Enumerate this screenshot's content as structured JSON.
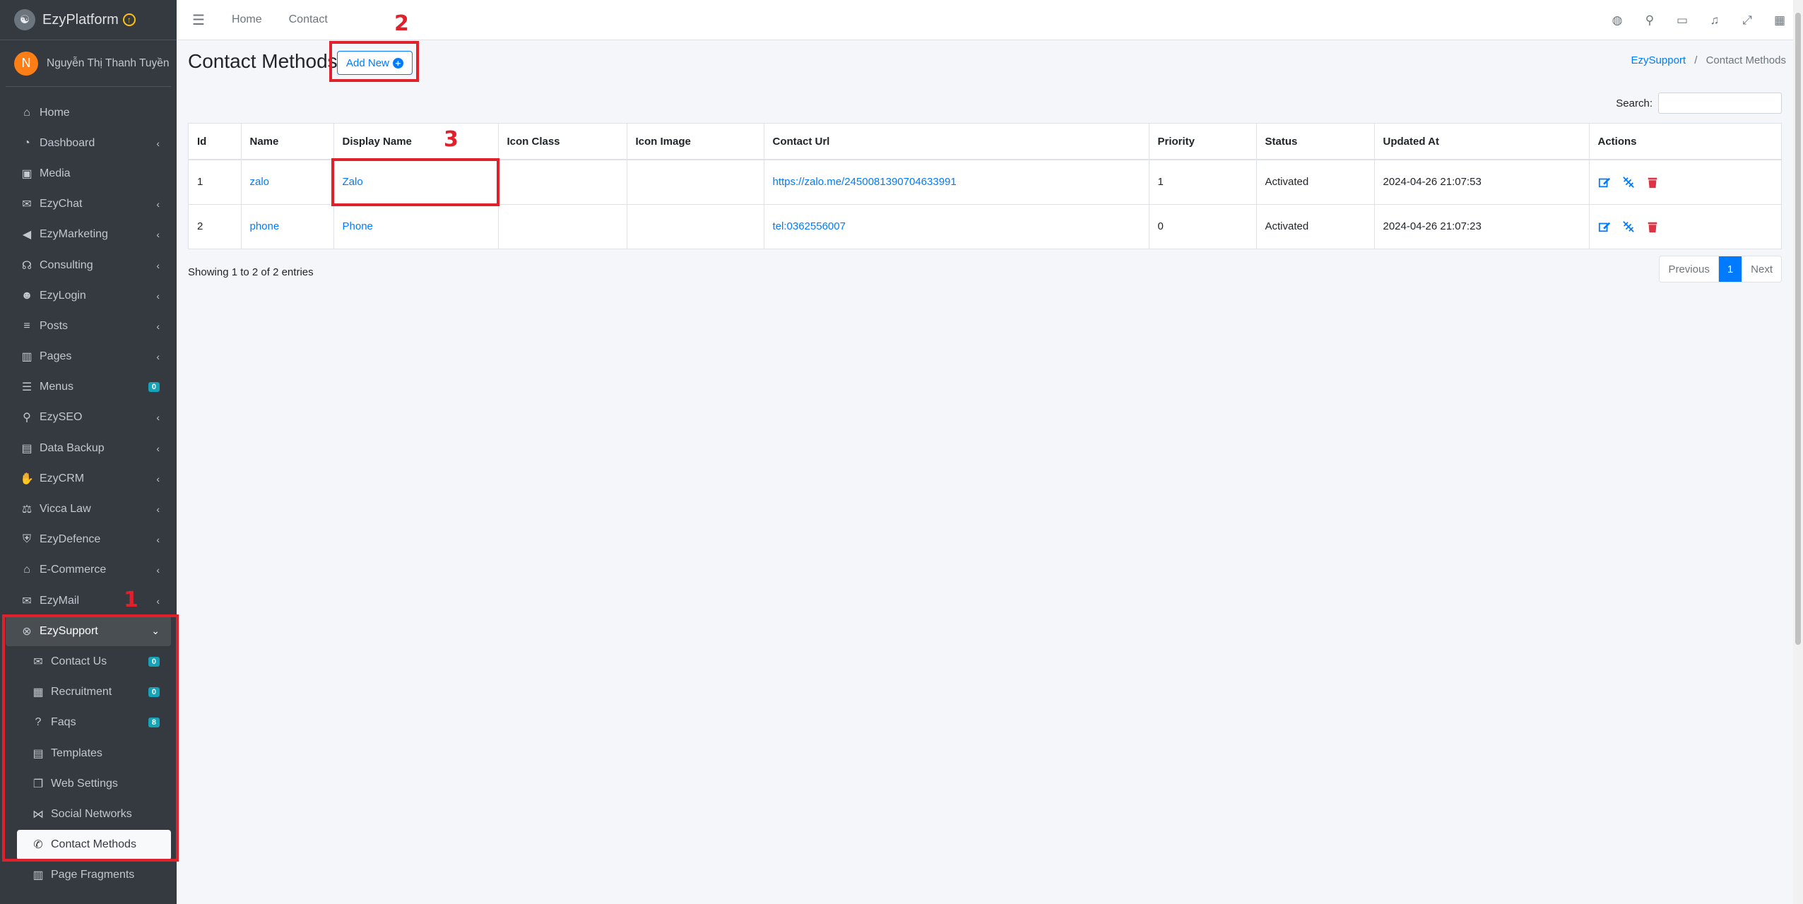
{
  "brand": {
    "name": "EzyPlatform"
  },
  "user": {
    "initial": "N",
    "name": "Nguyễn Thị Thanh Tuyền"
  },
  "sidebar": {
    "items": [
      {
        "label": "Home",
        "icon": "home-icon",
        "glyph": "⌂"
      },
      {
        "label": "Dashboard",
        "icon": "dashboard-icon",
        "glyph": "◔",
        "arrow": true
      },
      {
        "label": "Media",
        "icon": "image-icon",
        "glyph": "▣"
      },
      {
        "label": "EzyChat",
        "icon": "chat-icon",
        "glyph": "✉",
        "arrow": true
      },
      {
        "label": "EzyMarketing",
        "icon": "bullhorn-icon",
        "glyph": "◀",
        "arrow": true
      },
      {
        "label": "Consulting",
        "icon": "headset-icon",
        "glyph": "☊",
        "arrow": true
      },
      {
        "label": "EzyLogin",
        "icon": "user-lock-icon",
        "glyph": "☻",
        "arrow": true
      },
      {
        "label": "Posts",
        "icon": "list-icon",
        "glyph": "≡",
        "arrow": true
      },
      {
        "label": "Pages",
        "icon": "columns-icon",
        "glyph": "▥",
        "arrow": true
      },
      {
        "label": "Menus",
        "icon": "bars-icon",
        "glyph": "☰",
        "badge": "0"
      },
      {
        "label": "EzySEO",
        "icon": "search-plus-icon",
        "glyph": "⚲",
        "arrow": true
      },
      {
        "label": "Data Backup",
        "icon": "box-icon",
        "glyph": "▤",
        "arrow": true
      },
      {
        "label": "EzyCRM",
        "icon": "handshake-icon",
        "glyph": "✋",
        "arrow": true
      },
      {
        "label": "Vicca Law",
        "icon": "gavel-icon",
        "glyph": "⚖",
        "arrow": true
      },
      {
        "label": "EzyDefence",
        "icon": "shield-icon",
        "glyph": "⛨",
        "arrow": true
      },
      {
        "label": "E-Commerce",
        "icon": "store-icon",
        "glyph": "⌂",
        "arrow": true
      },
      {
        "label": "EzyMail",
        "icon": "envelope-icon",
        "glyph": "✉",
        "arrow": true
      }
    ],
    "open_item": {
      "label": "EzySupport",
      "icon": "support-icon",
      "glyph": "⊗"
    },
    "sub_items": [
      {
        "label": "Contact Us",
        "icon": "mailbox-icon",
        "glyph": "✉",
        "badge": "0"
      },
      {
        "label": "Recruitment",
        "icon": "grid-icon",
        "glyph": "▦",
        "badge": "0"
      },
      {
        "label": "Faqs",
        "icon": "question-icon",
        "glyph": "?",
        "badge": "8"
      },
      {
        "label": "Templates",
        "icon": "table-icon",
        "glyph": "▤"
      },
      {
        "label": "Web Settings",
        "icon": "window-icon",
        "glyph": "❐"
      },
      {
        "label": "Social Networks",
        "icon": "share-icon",
        "glyph": "⋈"
      },
      {
        "label": "Contact Methods",
        "icon": "phone-icon",
        "glyph": "✆",
        "active": true
      }
    ],
    "after_items": [
      {
        "label": "Page Fragments",
        "icon": "columns-icon",
        "glyph": "▥"
      }
    ]
  },
  "topbar": {
    "links": [
      "Home",
      "Contact"
    ],
    "icons": [
      "globe-icon",
      "search-icon",
      "comments-icon",
      "bell-icon",
      "expand-icon",
      "apps-icon"
    ]
  },
  "page": {
    "title": "Contact Methods",
    "add_button": "Add New",
    "breadcrumb": {
      "parent": "EzySupport",
      "current": "Contact Methods"
    },
    "search_label": "Search:",
    "search_value": ""
  },
  "table": {
    "columns": [
      "Id",
      "Name",
      "Display Name",
      "Icon Class",
      "Icon Image",
      "Contact Url",
      "Priority",
      "Status",
      "Updated At",
      "Actions"
    ],
    "rows": [
      {
        "id": "1",
        "name": "zalo",
        "display_name": "Zalo",
        "icon_class": "",
        "icon_image": "",
        "contact_url": "https://zalo.me/2450081390704633991",
        "priority": "1",
        "status": "Activated",
        "updated_at": "2024-04-26 21:07:53"
      },
      {
        "id": "2",
        "name": "phone",
        "display_name": "Phone",
        "icon_class": "",
        "icon_image": "",
        "contact_url": "tel:0362556007",
        "priority": "0",
        "status": "Activated",
        "updated_at": "2024-04-26 21:07:23"
      }
    ]
  },
  "footer": {
    "info": "Showing 1 to 2 of 2 entries",
    "pagination": {
      "previous": "Previous",
      "current": "1",
      "next": "Next"
    }
  },
  "annotations": {
    "one": "1",
    "two": "2",
    "three": "3"
  },
  "colors": {
    "accent": "#007bff",
    "annotation": "#e0202a",
    "sidebar_bg": "#343a40",
    "delete": "#dc3545"
  }
}
